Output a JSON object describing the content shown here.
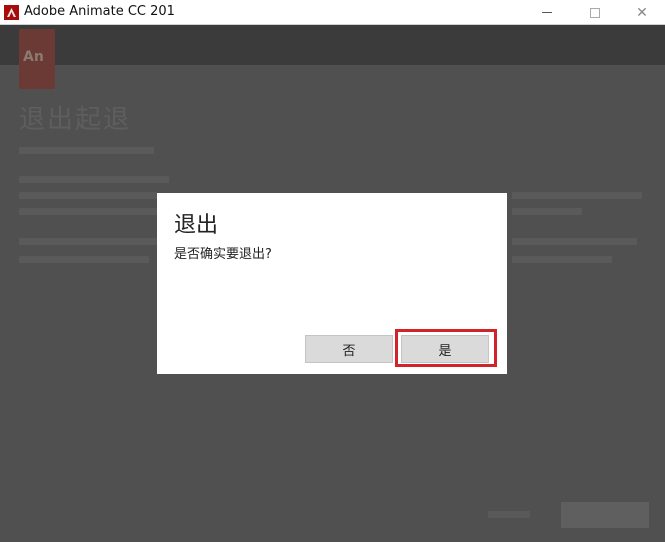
{
  "window": {
    "title": "Adobe Animate CC 201",
    "minimize_icon": "minimize-icon",
    "maximize_icon": "maximize-icon",
    "close_icon": "close-icon",
    "close_glyph": "✕"
  },
  "background": {
    "logo_text": "An",
    "title": "退出起退"
  },
  "dialog": {
    "title": "退出",
    "message": "是否确实要退出?",
    "no_label": "否",
    "yes_label": "是",
    "highlight_color": "#d2232a"
  }
}
